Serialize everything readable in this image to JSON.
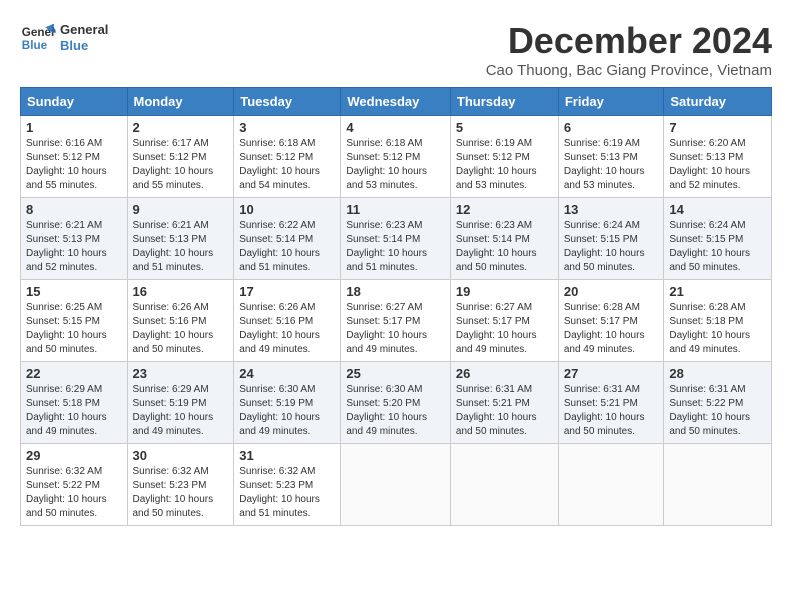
{
  "header": {
    "logo_line1": "General",
    "logo_line2": "Blue",
    "month": "December 2024",
    "location": "Cao Thuong, Bac Giang Province, Vietnam"
  },
  "weekdays": [
    "Sunday",
    "Monday",
    "Tuesday",
    "Wednesday",
    "Thursday",
    "Friday",
    "Saturday"
  ],
  "weeks": [
    [
      {
        "day": "1",
        "info": "Sunrise: 6:16 AM\nSunset: 5:12 PM\nDaylight: 10 hours\nand 55 minutes."
      },
      {
        "day": "2",
        "info": "Sunrise: 6:17 AM\nSunset: 5:12 PM\nDaylight: 10 hours\nand 55 minutes."
      },
      {
        "day": "3",
        "info": "Sunrise: 6:18 AM\nSunset: 5:12 PM\nDaylight: 10 hours\nand 54 minutes."
      },
      {
        "day": "4",
        "info": "Sunrise: 6:18 AM\nSunset: 5:12 PM\nDaylight: 10 hours\nand 53 minutes."
      },
      {
        "day": "5",
        "info": "Sunrise: 6:19 AM\nSunset: 5:12 PM\nDaylight: 10 hours\nand 53 minutes."
      },
      {
        "day": "6",
        "info": "Sunrise: 6:19 AM\nSunset: 5:13 PM\nDaylight: 10 hours\nand 53 minutes."
      },
      {
        "day": "7",
        "info": "Sunrise: 6:20 AM\nSunset: 5:13 PM\nDaylight: 10 hours\nand 52 minutes."
      }
    ],
    [
      {
        "day": "8",
        "info": "Sunrise: 6:21 AM\nSunset: 5:13 PM\nDaylight: 10 hours\nand 52 minutes."
      },
      {
        "day": "9",
        "info": "Sunrise: 6:21 AM\nSunset: 5:13 PM\nDaylight: 10 hours\nand 51 minutes."
      },
      {
        "day": "10",
        "info": "Sunrise: 6:22 AM\nSunset: 5:14 PM\nDaylight: 10 hours\nand 51 minutes."
      },
      {
        "day": "11",
        "info": "Sunrise: 6:23 AM\nSunset: 5:14 PM\nDaylight: 10 hours\nand 51 minutes."
      },
      {
        "day": "12",
        "info": "Sunrise: 6:23 AM\nSunset: 5:14 PM\nDaylight: 10 hours\nand 50 minutes."
      },
      {
        "day": "13",
        "info": "Sunrise: 6:24 AM\nSunset: 5:15 PM\nDaylight: 10 hours\nand 50 minutes."
      },
      {
        "day": "14",
        "info": "Sunrise: 6:24 AM\nSunset: 5:15 PM\nDaylight: 10 hours\nand 50 minutes."
      }
    ],
    [
      {
        "day": "15",
        "info": "Sunrise: 6:25 AM\nSunset: 5:15 PM\nDaylight: 10 hours\nand 50 minutes."
      },
      {
        "day": "16",
        "info": "Sunrise: 6:26 AM\nSunset: 5:16 PM\nDaylight: 10 hours\nand 50 minutes."
      },
      {
        "day": "17",
        "info": "Sunrise: 6:26 AM\nSunset: 5:16 PM\nDaylight: 10 hours\nand 49 minutes."
      },
      {
        "day": "18",
        "info": "Sunrise: 6:27 AM\nSunset: 5:17 PM\nDaylight: 10 hours\nand 49 minutes."
      },
      {
        "day": "19",
        "info": "Sunrise: 6:27 AM\nSunset: 5:17 PM\nDaylight: 10 hours\nand 49 minutes."
      },
      {
        "day": "20",
        "info": "Sunrise: 6:28 AM\nSunset: 5:17 PM\nDaylight: 10 hours\nand 49 minutes."
      },
      {
        "day": "21",
        "info": "Sunrise: 6:28 AM\nSunset: 5:18 PM\nDaylight: 10 hours\nand 49 minutes."
      }
    ],
    [
      {
        "day": "22",
        "info": "Sunrise: 6:29 AM\nSunset: 5:18 PM\nDaylight: 10 hours\nand 49 minutes."
      },
      {
        "day": "23",
        "info": "Sunrise: 6:29 AM\nSunset: 5:19 PM\nDaylight: 10 hours\nand 49 minutes."
      },
      {
        "day": "24",
        "info": "Sunrise: 6:30 AM\nSunset: 5:19 PM\nDaylight: 10 hours\nand 49 minutes."
      },
      {
        "day": "25",
        "info": "Sunrise: 6:30 AM\nSunset: 5:20 PM\nDaylight: 10 hours\nand 49 minutes."
      },
      {
        "day": "26",
        "info": "Sunrise: 6:31 AM\nSunset: 5:21 PM\nDaylight: 10 hours\nand 50 minutes."
      },
      {
        "day": "27",
        "info": "Sunrise: 6:31 AM\nSunset: 5:21 PM\nDaylight: 10 hours\nand 50 minutes."
      },
      {
        "day": "28",
        "info": "Sunrise: 6:31 AM\nSunset: 5:22 PM\nDaylight: 10 hours\nand 50 minutes."
      }
    ],
    [
      {
        "day": "29",
        "info": "Sunrise: 6:32 AM\nSunset: 5:22 PM\nDaylight: 10 hours\nand 50 minutes."
      },
      {
        "day": "30",
        "info": "Sunrise: 6:32 AM\nSunset: 5:23 PM\nDaylight: 10 hours\nand 50 minutes."
      },
      {
        "day": "31",
        "info": "Sunrise: 6:32 AM\nSunset: 5:23 PM\nDaylight: 10 hours\nand 51 minutes."
      },
      null,
      null,
      null,
      null
    ]
  ]
}
